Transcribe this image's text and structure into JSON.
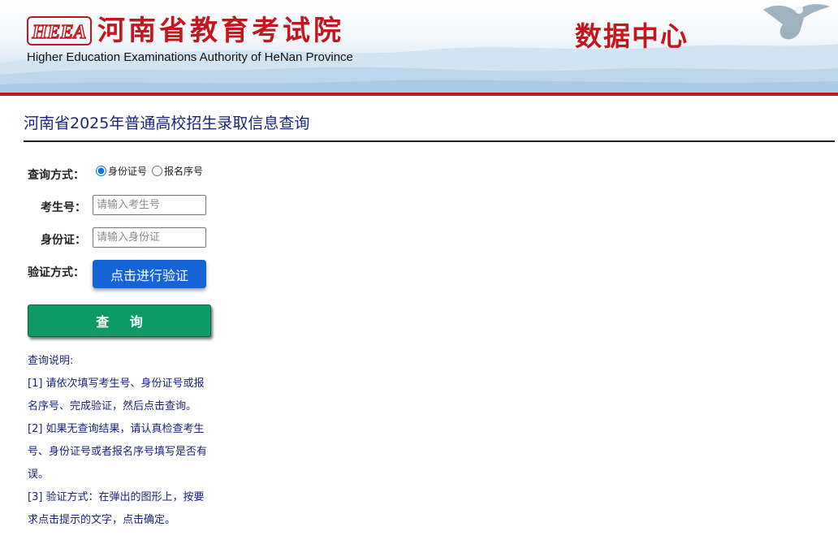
{
  "header": {
    "logo_text": "HEEA",
    "org_name": "河南省教育考试院",
    "org_name_en": "Higher Education Examinations Authority of HeNan Province",
    "data_center": "数据中心"
  },
  "page": {
    "title": "河南省2025年普通高校招生录取信息查询"
  },
  "form": {
    "query_mode_label": "查询方式：",
    "query_mode_options": [
      "身份证号",
      "报名序号"
    ],
    "query_mode_selected": "身份证号",
    "exam_no_label": "考生号：",
    "exam_no_placeholder": "请输入考生号",
    "exam_no_value": "",
    "id_label": "身份证：",
    "id_placeholder": "请输入身份证",
    "id_value": "",
    "verify_label": "验证方式：",
    "verify_button": "点击进行验证",
    "query_button": "查 询"
  },
  "notes": {
    "heading": "查询说明:",
    "items": [
      "[1] 请依次填写考生号、身份证号或报名序号、完成验证，然后点击查询。",
      "[2] 如果无查询结果，请认真检查考生号、身份证号或者报名序号填写是否有误。",
      "[3] 验证方式：在弹出的图形上，按要求点击提示的文字，点击确定。"
    ]
  },
  "colors": {
    "brand_red": "#c4161c",
    "title_blue": "#1a237e",
    "verify_blue": "#1464d8",
    "query_green": "#0e9a67"
  },
  "icons": {
    "logo": "heea-logo-icon",
    "mascot": "eagle-icon"
  }
}
